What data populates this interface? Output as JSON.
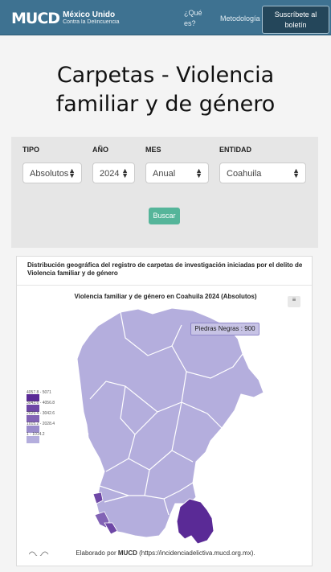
{
  "header": {
    "logo_mark": "MUCD",
    "logo_line1": "México Unido",
    "logo_line2": "Contra la Delincuencia",
    "nav_que": "¿Qué es?",
    "nav_metodologia": "Metodología",
    "subscribe": "Suscríbete al boletín"
  },
  "page_title": "Carpetas - Violencia familiar y de género",
  "filters": {
    "tipo": {
      "label": "TIPO",
      "value": "Absolutos"
    },
    "anio": {
      "label": "AÑO",
      "value": "2024"
    },
    "mes": {
      "label": "MES",
      "value": "Anual"
    },
    "entidad": {
      "label": "ENTIDAD",
      "value": "Coahuila"
    },
    "search_button": "Buscar"
  },
  "card": {
    "heading": "Distribución geográfica del registro de carpetas de investigación iniciadas por el delito de Violencia familiar y de género",
    "menu_icon": "≡"
  },
  "chart_data": {
    "type": "choropleth",
    "title": "Violencia familiar y de género en Coahuila 2024 (Absolutos)",
    "tooltip": "Piedras Negras : 900",
    "legend": [
      {
        "label": "4057.8 - 5071",
        "color": "#5a2a96"
      },
      {
        "label": "3043.6 - 4056.8",
        "color": "#6e47a6"
      },
      {
        "label": "2029.4 - 3042.6",
        "color": "#8263b5"
      },
      {
        "label": "1015.2 - 2028.4",
        "color": "#9a8ccb"
      },
      {
        "label": "1 - 1014.2",
        "color": "#b4aedd"
      }
    ]
  },
  "credit": {
    "prefix": "Elaborado por",
    "org": "MUCD",
    "url": "(https://incidenciadelictiva.mucd.org.mx)."
  }
}
